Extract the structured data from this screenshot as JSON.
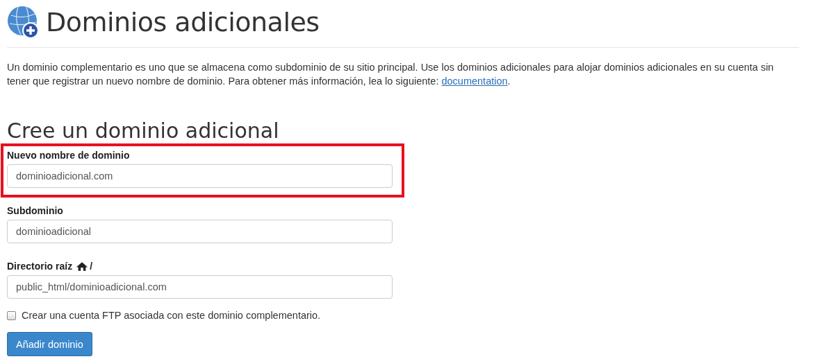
{
  "page": {
    "title": "Dominios adicionales"
  },
  "intro": {
    "text": "Un dominio complementario es uno que se almacena como subdominio de su sitio principal. Use los dominios adicionales para alojar dominios adicionales en su cuenta sin tener que registrar un nuevo nombre de dominio. Para obtener más información, lea lo siguiente:",
    "link": "documentation",
    "end": "."
  },
  "form": {
    "heading": "Cree un dominio adicional",
    "fields": [
      {
        "label": "Nuevo nombre de dominio",
        "value": "dominioadicional.com",
        "highlighted": true
      },
      {
        "label": "Subdominio",
        "value": "dominioadicional",
        "highlighted": false
      },
      {
        "label": "Directorio raíz",
        "home_icon": true,
        "label_suffix": "/",
        "value": "public_html/dominioadicional.com",
        "highlighted": false
      }
    ],
    "checkbox": {
      "label": "Crear una cuenta FTP asociada con este dominio complementario.",
      "checked": false
    },
    "submit": "Añadir dominio"
  }
}
